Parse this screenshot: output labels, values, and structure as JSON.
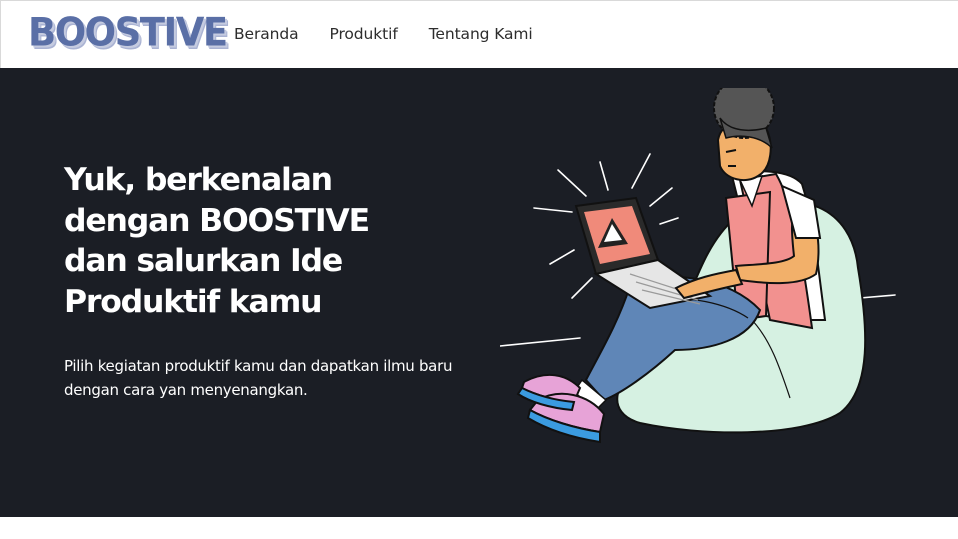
{
  "brand": {
    "logo_text": "BOOSTIVE"
  },
  "nav": {
    "items": [
      {
        "label": "Beranda"
      },
      {
        "label": "Produktif"
      },
      {
        "label": "Tentang Kami"
      }
    ]
  },
  "hero": {
    "title": "Yuk, berkenalan dengan BOOSTIVE dan salurkan Ide Produktif kamu",
    "subtitle": "Pilih kegiatan produktif kamu dan dapatkan ilmu baru dengan cara yan menyenangkan.",
    "illustration": "person-with-laptop-warning"
  },
  "colors": {
    "hero_background": "#1b1e25",
    "logo": "#5a6fa6",
    "laptop_screen": "#f08a7a",
    "beanbag": "#d6f1e2",
    "jeans": "#5f86b7"
  }
}
